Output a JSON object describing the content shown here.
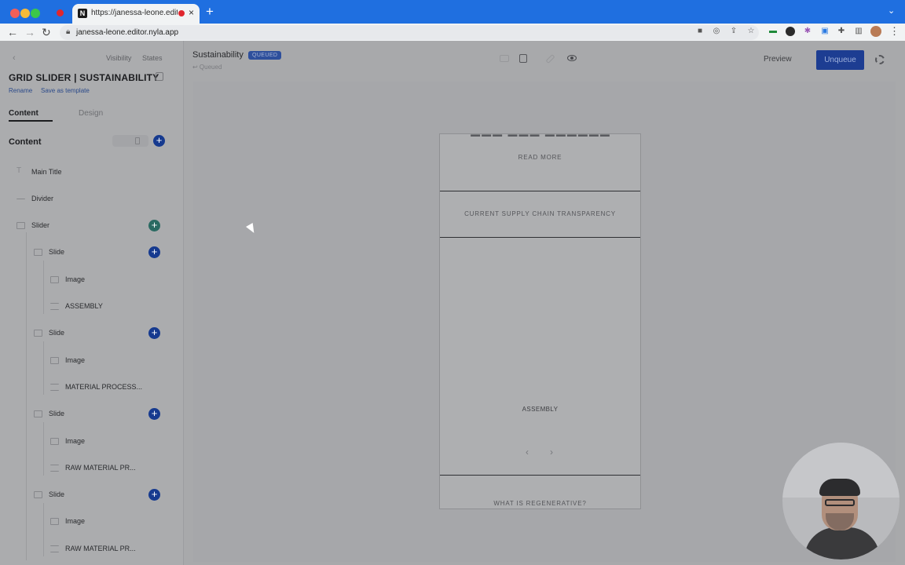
{
  "browser": {
    "tab_title": "https://janessa-leone.editor.nyla.app",
    "favicon_letter": "N",
    "close_glyph": "×",
    "new_tab_glyph": "+",
    "tab_menu_glyph": "⌄",
    "url": "janessa-leone.editor.nyla.app",
    "back_glyph": "←",
    "forward_glyph": "→",
    "reload_glyph": "↻",
    "menu_glyph": "⋮"
  },
  "sidebar": {
    "back_glyph": "‹",
    "top_links": [
      "Visibility",
      "States"
    ],
    "widget_title": "GRID SLIDER | SUSTAINABILITY",
    "rename": "Rename",
    "save_as_template": "Save as template",
    "tabs": [
      "Content",
      "Design"
    ],
    "section_title": "Content",
    "tree": [
      {
        "label": "Main Title",
        "icon": "title-icon"
      },
      {
        "label": "Divider",
        "icon": "divider-icon"
      },
      {
        "label": "Slider",
        "icon": "slider-icon"
      },
      {
        "label": "Slide",
        "icon": "slide-icon"
      },
      {
        "label": "Image",
        "icon": "image-icon"
      },
      {
        "label": "ASSEMBLY",
        "icon": "text-icon"
      },
      {
        "label": "Slide",
        "icon": "slide-icon"
      },
      {
        "label": "Image",
        "icon": "image-icon"
      },
      {
        "label": "MATERIAL PROCESS...",
        "icon": "text-icon"
      },
      {
        "label": "Slide",
        "icon": "slide-icon"
      },
      {
        "label": "Image",
        "icon": "image-icon"
      },
      {
        "label": "RAW MATERIAL PR...",
        "icon": "text-icon"
      },
      {
        "label": "Slide",
        "icon": "slide-icon"
      },
      {
        "label": "Image",
        "icon": "image-icon"
      },
      {
        "label": "RAW MATERIAL PR...",
        "icon": "text-icon"
      }
    ]
  },
  "header": {
    "page_title": "Sustainability",
    "status_badge": "Queued",
    "sub_status": "↩ Queued",
    "preview": "Preview",
    "unqueue": "Unqueue"
  },
  "preview": {
    "read_more": "READ MORE",
    "supply_chain": "CURRENT SUPPLY CHAIN TRANSPARENCY",
    "slide_label": "ASSEMBLY",
    "prev_glyph": "‹",
    "next_glyph": "›",
    "regenerative": "WHAT IS REGENERATIVE?"
  },
  "colors": {
    "chrome_blue": "#1f6fe0",
    "primary_button": "#1d3d92",
    "plus_button": "#163a8f",
    "overlay_gray": "#a8a9ab"
  }
}
